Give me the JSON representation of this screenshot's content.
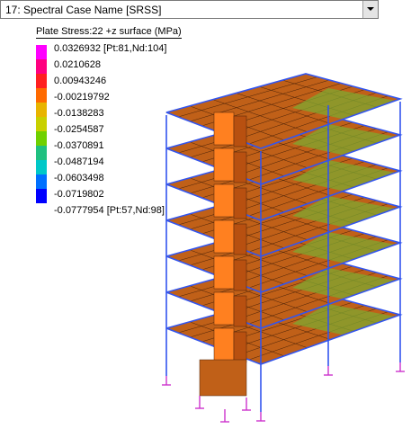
{
  "case_selector": {
    "value": "17: Spectral Case Name [SRSS]"
  },
  "legend": {
    "title": "Plate Stress:22 +z surface (MPa)",
    "labels": [
      "0.0326932 [Pt:81,Nd:104]",
      "0.0210628",
      "0.00943246",
      "-0.00219792",
      "-0.0138283",
      "-0.0254587",
      "-0.0370891",
      "-0.0487194",
      "-0.0603498",
      "-0.0719802",
      "-0.0777954 [Pt:57,Nd:98]"
    ],
    "colors": [
      "#ff00ff",
      "#ff0080",
      "#ff2020",
      "#ff6a00",
      "#e8b400",
      "#c8d000",
      "#70d000",
      "#20c080",
      "#00c8c8",
      "#0070ff",
      "#0000ff"
    ]
  },
  "model": {
    "frame_color": "#3355ee",
    "support_color": "#cc33cc",
    "plate_color": "#c06018",
    "core_color": "#ff8020"
  }
}
